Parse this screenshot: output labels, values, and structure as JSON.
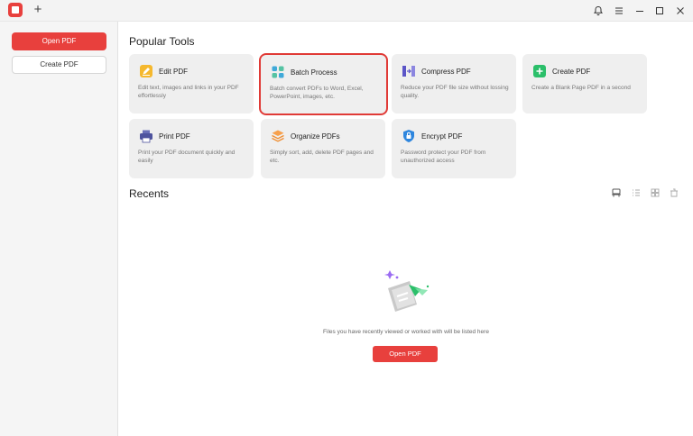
{
  "titlebar": {
    "icons": [
      "bell-icon",
      "menu-icon",
      "minimize-icon",
      "maximize-icon",
      "close-icon"
    ],
    "new_tab": "+"
  },
  "sidebar": {
    "open_label": "Open PDF",
    "create_label": "Create PDF"
  },
  "popular": {
    "title": "Popular Tools",
    "tools": [
      {
        "name": "Edit PDF",
        "desc": "Edit text, images and links in your PDF effortlessly",
        "icon": "edit-pdf-icon"
      },
      {
        "name": "Batch Process",
        "desc": "Batch convert PDFs to Word, Excel, PowerPoint, images, etc.",
        "icon": "batch-process-icon"
      },
      {
        "name": "Compress PDF",
        "desc": "Reduce your PDF file size without lossing quality.",
        "icon": "compress-pdf-icon"
      },
      {
        "name": "Create PDF",
        "desc": "Create a Blank Page PDF in a second",
        "icon": "create-pdf-icon"
      },
      {
        "name": "Print PDF",
        "desc": "Print your PDF document quickly and easily",
        "icon": "print-pdf-icon"
      },
      {
        "name": "Organize PDFs",
        "desc": "Simply sort, add, delete PDF pages and etc.",
        "icon": "organize-pdfs-icon"
      },
      {
        "name": "Encrypt PDF",
        "desc": "Password protect your PDF from unauthorized access",
        "icon": "encrypt-pdf-icon"
      }
    ]
  },
  "recents": {
    "title": "Recents",
    "empty_text": "Files you have recently viewed or worked with will be listed here",
    "open_label": "Open PDF"
  },
  "colors": {
    "accent": "#e8403d",
    "card_bg": "#efefef",
    "selected_outline": "#e03a36"
  }
}
